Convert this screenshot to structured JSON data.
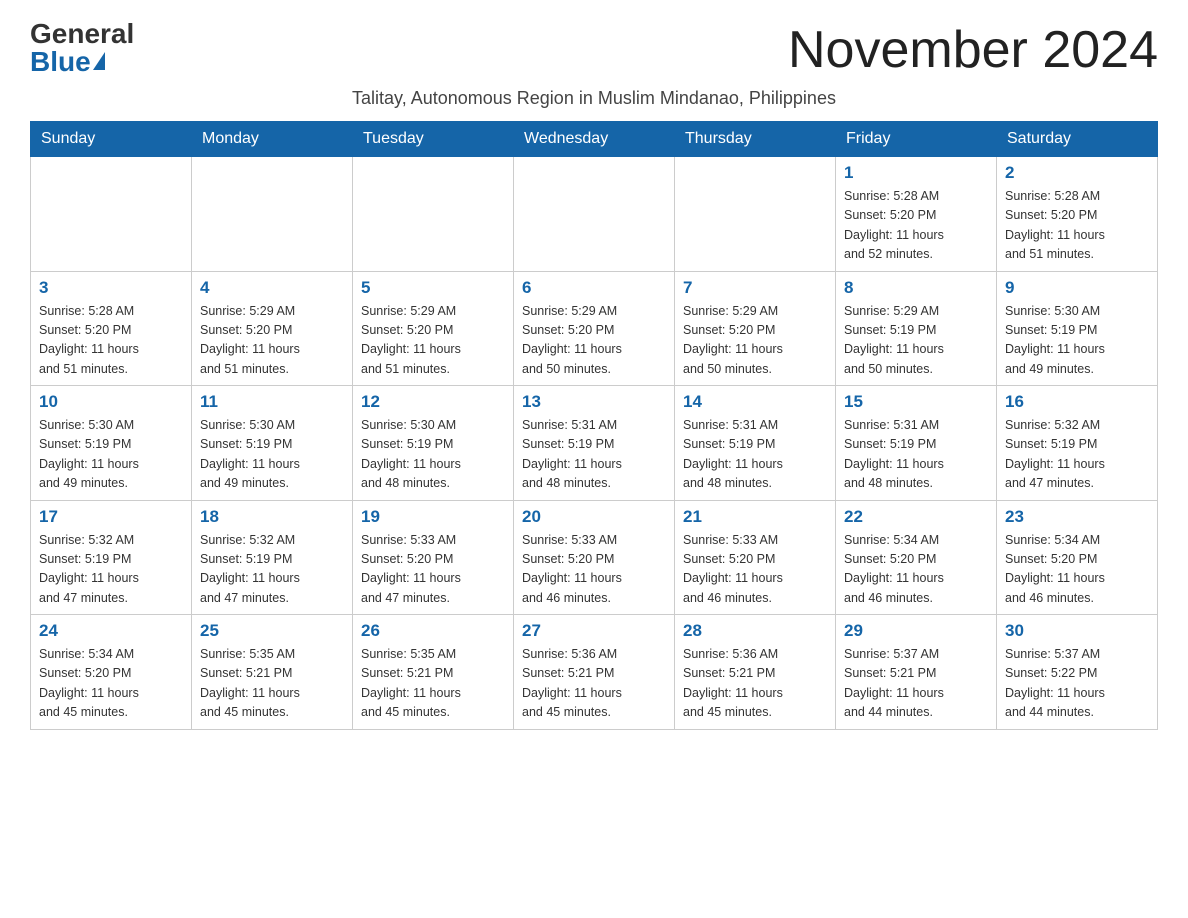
{
  "logo": {
    "general": "General",
    "blue": "Blue"
  },
  "title": "November 2024",
  "subtitle": "Talitay, Autonomous Region in Muslim Mindanao, Philippines",
  "headers": [
    "Sunday",
    "Monday",
    "Tuesday",
    "Wednesday",
    "Thursday",
    "Friday",
    "Saturday"
  ],
  "weeks": [
    [
      {
        "day": "",
        "info": ""
      },
      {
        "day": "",
        "info": ""
      },
      {
        "day": "",
        "info": ""
      },
      {
        "day": "",
        "info": ""
      },
      {
        "day": "",
        "info": ""
      },
      {
        "day": "1",
        "info": "Sunrise: 5:28 AM\nSunset: 5:20 PM\nDaylight: 11 hours\nand 52 minutes."
      },
      {
        "day": "2",
        "info": "Sunrise: 5:28 AM\nSunset: 5:20 PM\nDaylight: 11 hours\nand 51 minutes."
      }
    ],
    [
      {
        "day": "3",
        "info": "Sunrise: 5:28 AM\nSunset: 5:20 PM\nDaylight: 11 hours\nand 51 minutes."
      },
      {
        "day": "4",
        "info": "Sunrise: 5:29 AM\nSunset: 5:20 PM\nDaylight: 11 hours\nand 51 minutes."
      },
      {
        "day": "5",
        "info": "Sunrise: 5:29 AM\nSunset: 5:20 PM\nDaylight: 11 hours\nand 51 minutes."
      },
      {
        "day": "6",
        "info": "Sunrise: 5:29 AM\nSunset: 5:20 PM\nDaylight: 11 hours\nand 50 minutes."
      },
      {
        "day": "7",
        "info": "Sunrise: 5:29 AM\nSunset: 5:20 PM\nDaylight: 11 hours\nand 50 minutes."
      },
      {
        "day": "8",
        "info": "Sunrise: 5:29 AM\nSunset: 5:19 PM\nDaylight: 11 hours\nand 50 minutes."
      },
      {
        "day": "9",
        "info": "Sunrise: 5:30 AM\nSunset: 5:19 PM\nDaylight: 11 hours\nand 49 minutes."
      }
    ],
    [
      {
        "day": "10",
        "info": "Sunrise: 5:30 AM\nSunset: 5:19 PM\nDaylight: 11 hours\nand 49 minutes."
      },
      {
        "day": "11",
        "info": "Sunrise: 5:30 AM\nSunset: 5:19 PM\nDaylight: 11 hours\nand 49 minutes."
      },
      {
        "day": "12",
        "info": "Sunrise: 5:30 AM\nSunset: 5:19 PM\nDaylight: 11 hours\nand 48 minutes."
      },
      {
        "day": "13",
        "info": "Sunrise: 5:31 AM\nSunset: 5:19 PM\nDaylight: 11 hours\nand 48 minutes."
      },
      {
        "day": "14",
        "info": "Sunrise: 5:31 AM\nSunset: 5:19 PM\nDaylight: 11 hours\nand 48 minutes."
      },
      {
        "day": "15",
        "info": "Sunrise: 5:31 AM\nSunset: 5:19 PM\nDaylight: 11 hours\nand 48 minutes."
      },
      {
        "day": "16",
        "info": "Sunrise: 5:32 AM\nSunset: 5:19 PM\nDaylight: 11 hours\nand 47 minutes."
      }
    ],
    [
      {
        "day": "17",
        "info": "Sunrise: 5:32 AM\nSunset: 5:19 PM\nDaylight: 11 hours\nand 47 minutes."
      },
      {
        "day": "18",
        "info": "Sunrise: 5:32 AM\nSunset: 5:19 PM\nDaylight: 11 hours\nand 47 minutes."
      },
      {
        "day": "19",
        "info": "Sunrise: 5:33 AM\nSunset: 5:20 PM\nDaylight: 11 hours\nand 47 minutes."
      },
      {
        "day": "20",
        "info": "Sunrise: 5:33 AM\nSunset: 5:20 PM\nDaylight: 11 hours\nand 46 minutes."
      },
      {
        "day": "21",
        "info": "Sunrise: 5:33 AM\nSunset: 5:20 PM\nDaylight: 11 hours\nand 46 minutes."
      },
      {
        "day": "22",
        "info": "Sunrise: 5:34 AM\nSunset: 5:20 PM\nDaylight: 11 hours\nand 46 minutes."
      },
      {
        "day": "23",
        "info": "Sunrise: 5:34 AM\nSunset: 5:20 PM\nDaylight: 11 hours\nand 46 minutes."
      }
    ],
    [
      {
        "day": "24",
        "info": "Sunrise: 5:34 AM\nSunset: 5:20 PM\nDaylight: 11 hours\nand 45 minutes."
      },
      {
        "day": "25",
        "info": "Sunrise: 5:35 AM\nSunset: 5:21 PM\nDaylight: 11 hours\nand 45 minutes."
      },
      {
        "day": "26",
        "info": "Sunrise: 5:35 AM\nSunset: 5:21 PM\nDaylight: 11 hours\nand 45 minutes."
      },
      {
        "day": "27",
        "info": "Sunrise: 5:36 AM\nSunset: 5:21 PM\nDaylight: 11 hours\nand 45 minutes."
      },
      {
        "day": "28",
        "info": "Sunrise: 5:36 AM\nSunset: 5:21 PM\nDaylight: 11 hours\nand 45 minutes."
      },
      {
        "day": "29",
        "info": "Sunrise: 5:37 AM\nSunset: 5:21 PM\nDaylight: 11 hours\nand 44 minutes."
      },
      {
        "day": "30",
        "info": "Sunrise: 5:37 AM\nSunset: 5:22 PM\nDaylight: 11 hours\nand 44 minutes."
      }
    ]
  ]
}
